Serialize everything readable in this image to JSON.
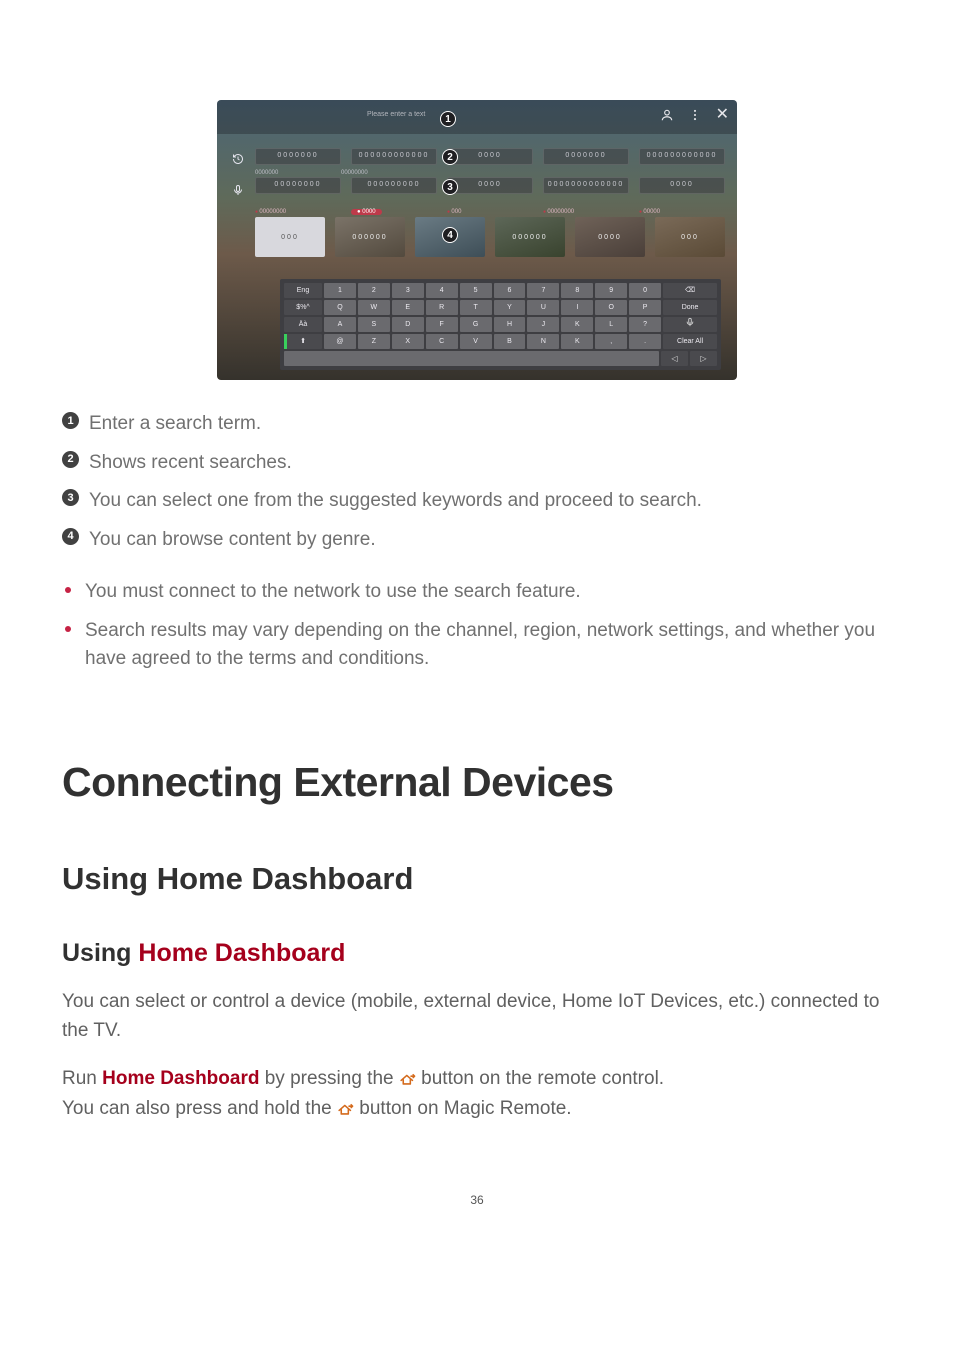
{
  "screenshot": {
    "search_placeholder": "Please enter a text",
    "history_label": "0000000",
    "suggested_label": "00000000",
    "icons": {
      "user": "user-icon",
      "more": "more-icon",
      "close": "close-icon",
      "history": "history-icon",
      "mic": "mic-icon"
    },
    "callouts": {
      "c1": "1",
      "c2": "2",
      "c3": "3",
      "c4": "4"
    },
    "keyboard": {
      "row_side": [
        "Eng",
        "$%^",
        "Äà",
        "⇧"
      ],
      "row1": [
        "1",
        "2",
        "3",
        "4",
        "5",
        "6",
        "7",
        "8",
        "9",
        "0"
      ],
      "row2": [
        "Q",
        "W",
        "E",
        "R",
        "T",
        "Y",
        "U",
        "I",
        "O",
        "P"
      ],
      "row3": [
        "A",
        "S",
        "D",
        "F",
        "G",
        "H",
        "J",
        "K",
        "L",
        "?"
      ],
      "row4": [
        "@",
        "Z",
        "X",
        "C",
        "V",
        "B",
        "N",
        "K",
        ",",
        "."
      ],
      "actions": {
        "backspace": "⌫",
        "done": "Done",
        "voice": "🎤",
        "clear": "Clear All",
        "left": "◁",
        "right": "▷",
        "space": "⎵"
      }
    },
    "tiles": [
      "000",
      "000000",
      "00",
      "000000",
      "0000",
      "000"
    ]
  },
  "definitions": {
    "d1": "Enter a search term.",
    "d2": "Shows recent searches.",
    "d3": "You can select one from the suggested keywords and proceed to search.",
    "d4": "You can browse content by genre."
  },
  "notes": {
    "n1": "You must connect to the network to use the search feature.",
    "n2": "Search results may vary depending on the channel, region, network settings, and whether you have agreed to the terms and conditions."
  },
  "h1": "Connecting External Devices",
  "h2": "Using Home Dashboard",
  "h3_prefix": "Using ",
  "h3_accent": "Home Dashboard",
  "para1": "You can select or control a device (mobile, external device, Home IoT Devices, etc.) connected to the TV.",
  "para2_a": "Run ",
  "para2_brand": "Home Dashboard",
  "para2_b": " by pressing the ",
  "para2_c": " button on the remote control.",
  "para3_a": "You can also press and hold the ",
  "para3_b": " button on Magic Remote.",
  "page_no": "36"
}
